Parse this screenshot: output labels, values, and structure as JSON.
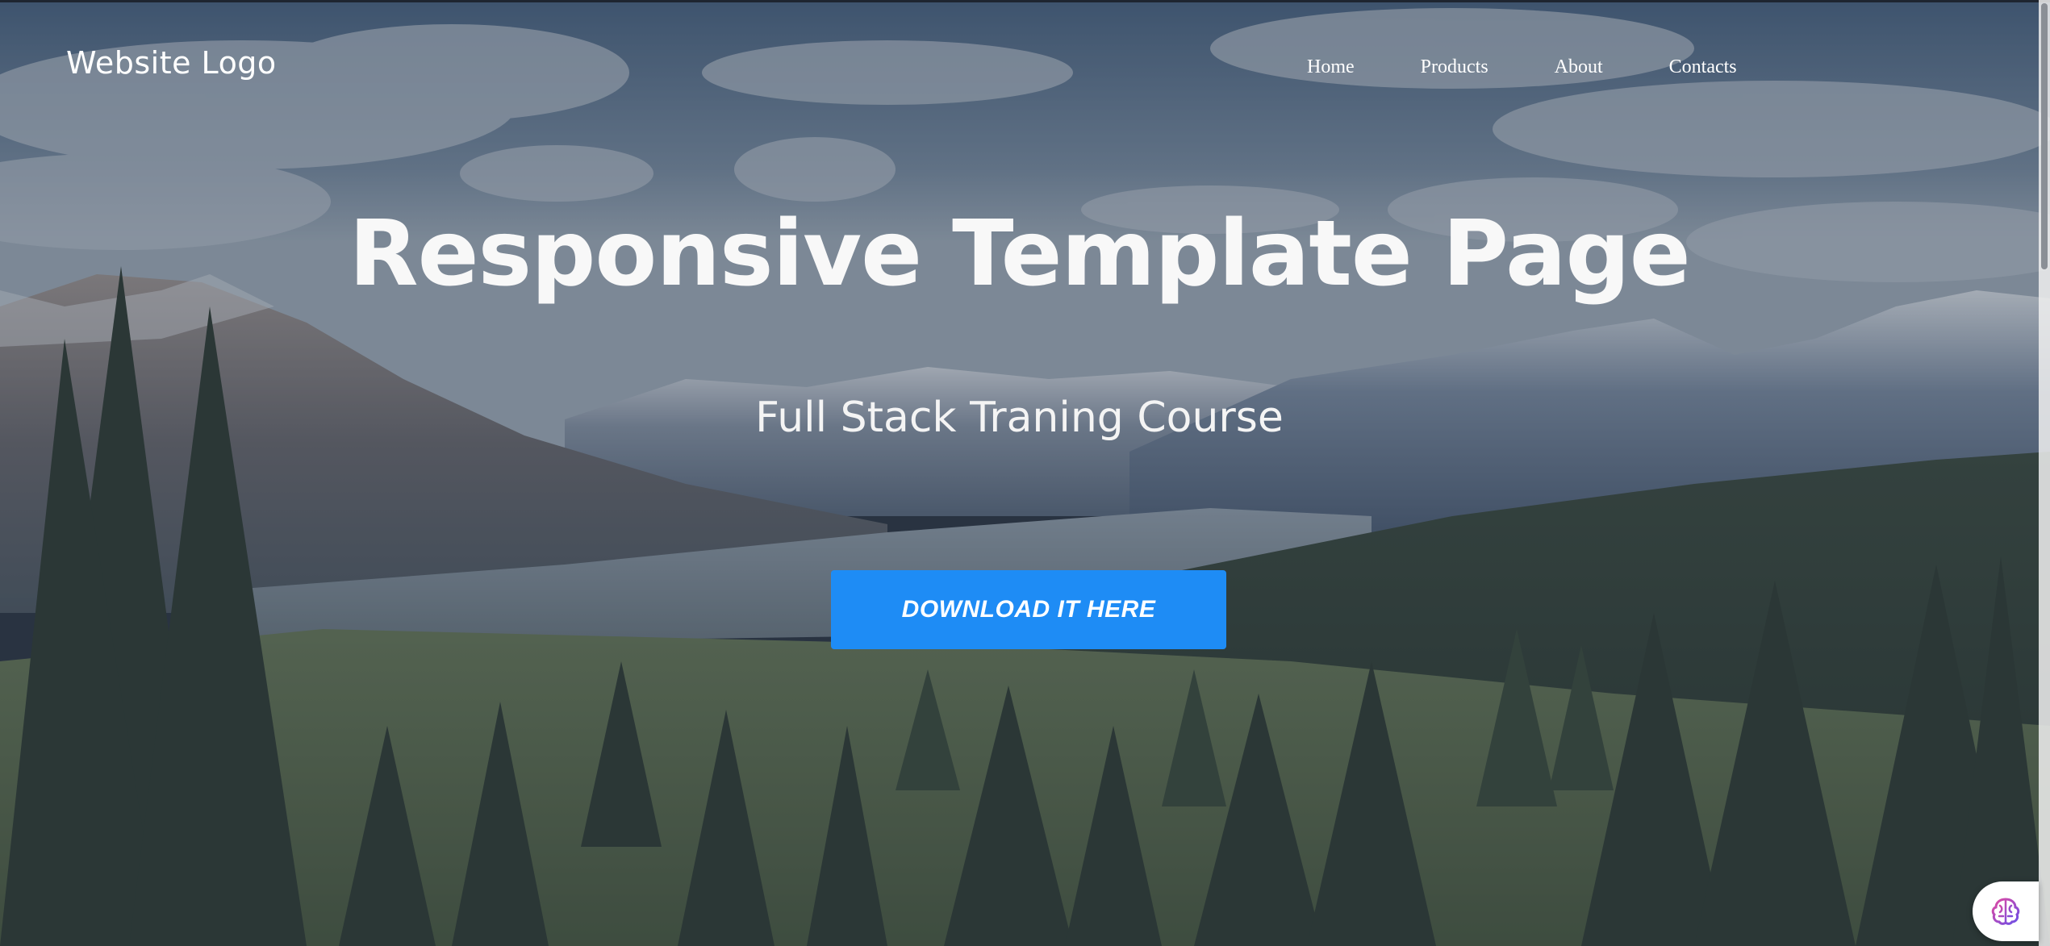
{
  "header": {
    "logo_text": "Website Logo",
    "nav": [
      {
        "label": "Home"
      },
      {
        "label": "Products"
      },
      {
        "label": "About"
      },
      {
        "label": "Contacts"
      }
    ]
  },
  "hero": {
    "title": "Responsive Template Page",
    "subtitle": "Full Stack Traning Course",
    "cta_label": "DOWNLOAD IT HERE",
    "background": "mountain-forest-landscape-image"
  },
  "widget": {
    "icon": "brain-icon"
  },
  "colors": {
    "accent": "#1e8cf5",
    "text": "#ffffff",
    "overlay": "#283446"
  }
}
